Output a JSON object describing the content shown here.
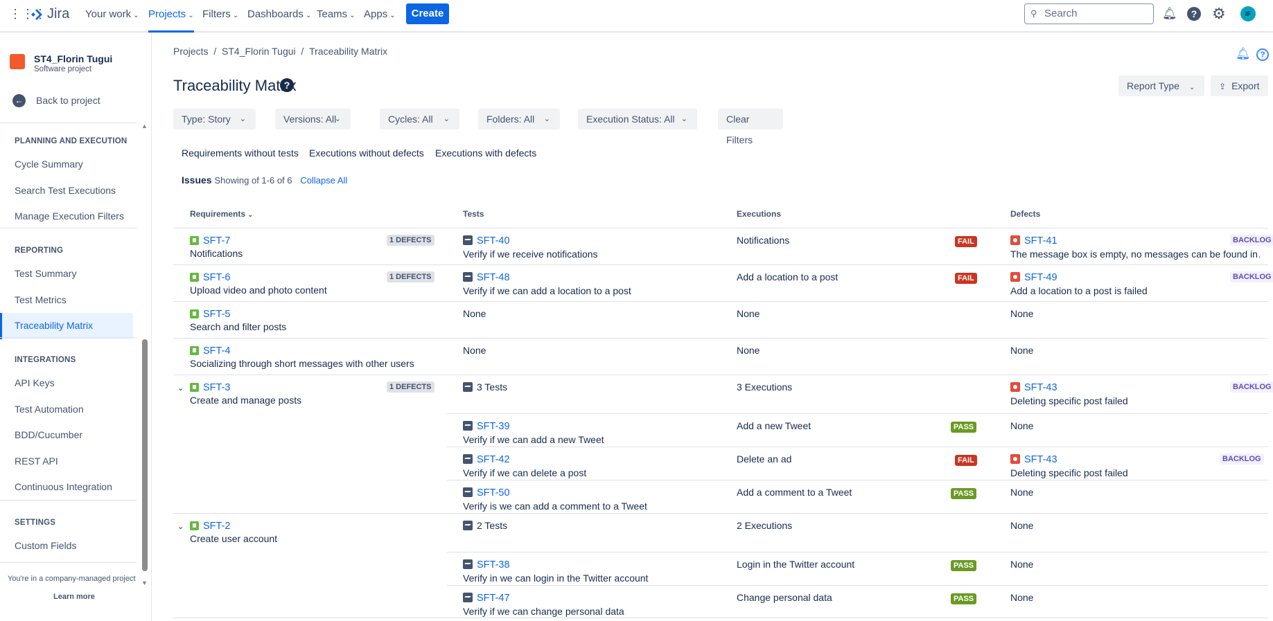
{
  "topbar": {
    "logo": "Jira",
    "nav": [
      {
        "label": "Your work"
      },
      {
        "label": "Projects",
        "active": true
      },
      {
        "label": "Filters"
      },
      {
        "label": "Dashboards"
      },
      {
        "label": "Teams"
      },
      {
        "label": "Apps"
      }
    ],
    "create": "Create",
    "search_placeholder": "Search",
    "avatar": "IF",
    "avatar_color": "#00a3bf"
  },
  "sidebar": {
    "project_name": "ST4_Florin Tugui",
    "project_type": "Software project",
    "back": "Back to project",
    "sections": [
      {
        "title": "PLANNING AND EXECUTION",
        "items": [
          "Cycle Summary",
          "Search Test Executions",
          "Manage Execution Filters"
        ]
      },
      {
        "title": "REPORTING",
        "items": [
          "Test Summary",
          "Test Metrics",
          "Traceability Matrix"
        ]
      },
      {
        "title": "INTEGRATIONS",
        "items": [
          "API Keys",
          "Test Automation",
          "BDD/Cucumber",
          "REST API",
          "Continuous Integration"
        ]
      },
      {
        "title": "SETTINGS",
        "items": [
          "Custom Fields"
        ]
      }
    ],
    "selected": "Traceability Matrix",
    "footer": "You're in a company-managed project",
    "learn_more": "Learn more"
  },
  "breadcrumb": [
    "Projects",
    "ST4_Florin Tugui",
    "Traceability Matrix"
  ],
  "title": "Traceability Matrix",
  "actions": {
    "report_type": "Report Type",
    "export": "Export"
  },
  "filters": [
    "Type: Story",
    "Versions: All",
    "Cycles: All",
    "Folders: All",
    "Execution Status: All"
  ],
  "clear_filters": "Clear Filters",
  "tabs": [
    "Requirements without tests",
    "Executions without defects",
    "Executions with defects"
  ],
  "summary": {
    "label": "Issues",
    "showing": "Showing of 1-6 of 6",
    "collapse": "Collapse All"
  },
  "columns": [
    "Requirements",
    "Tests",
    "Executions",
    "Defects"
  ],
  "rows": [
    {
      "key": "SFT-7",
      "summary": "Notifications",
      "defects_badge": "1 DEFECTS",
      "subs": [
        {
          "test_key": "SFT-40",
          "test": "Verify if we receive notifications",
          "execution": "Notifications",
          "status": "FAIL",
          "defect_key": "SFT-41",
          "defect": "The message box is empty, no messages can be found in…",
          "defect_status": "BACKLOG"
        }
      ]
    },
    {
      "key": "SFT-6",
      "summary": "Upload video and photo content",
      "defects_badge": "1 DEFECTS",
      "subs": [
        {
          "test_key": "SFT-48",
          "test": "Verify if we can add a location to a post",
          "execution": "Add a location to a post",
          "status": "FAIL",
          "defect_key": "SFT-49",
          "defect": "Add a location to a post is failed",
          "defect_status": "BACKLOG"
        }
      ]
    },
    {
      "key": "SFT-5",
      "summary": "Search and filter posts",
      "subs": [
        {
          "test": "None",
          "execution": "None",
          "defect": "None"
        }
      ]
    },
    {
      "key": "SFT-4",
      "summary": "Socializing through short messages with other users",
      "subs": [
        {
          "test": "None",
          "execution": "None",
          "defect": "None"
        }
      ]
    },
    {
      "key": "SFT-3",
      "summary": "Create and manage posts",
      "defects_badge": "1 DEFECTS",
      "expanded": true,
      "subs": [
        {
          "test_count": "3 Tests",
          "execution": "3 Executions",
          "defect_key": "SFT-43",
          "defect": "Deleting specific post failed",
          "defect_status": "BACKLOG"
        },
        {
          "test_key": "SFT-39",
          "test": "Verify if we can add a new Tweet",
          "execution": "Add a new Tweet",
          "status": "PASS",
          "defect": "None"
        },
        {
          "test_key": "SFT-42",
          "test": "Verify if we can delete a post",
          "execution": "Delete an ad",
          "status": "FAIL",
          "defect_key": "SFT-43",
          "defect": "Deleting specific post failed",
          "defect_status": "BACKLOG"
        },
        {
          "test_key": "SFT-50",
          "test": "Verify is we can add a comment to a Tweet",
          "execution": "Add a comment to a Tweet",
          "status": "PASS",
          "defect": "None"
        }
      ]
    },
    {
      "key": "SFT-2",
      "summary": "Create user account",
      "expanded": true,
      "subs": [
        {
          "test_count": "2 Tests",
          "execution": "2 Executions",
          "defect": "None"
        },
        {
          "test_key": "SFT-38",
          "test": "Verify in we can login in the Twitter account",
          "execution": "Login in the Twitter account",
          "status": "PASS",
          "defect": "None"
        },
        {
          "test_key": "SFT-47",
          "test": "Verify if we can change personal data",
          "execution": "Change personal data",
          "status": "PASS",
          "defect": "None"
        }
      ]
    }
  ]
}
